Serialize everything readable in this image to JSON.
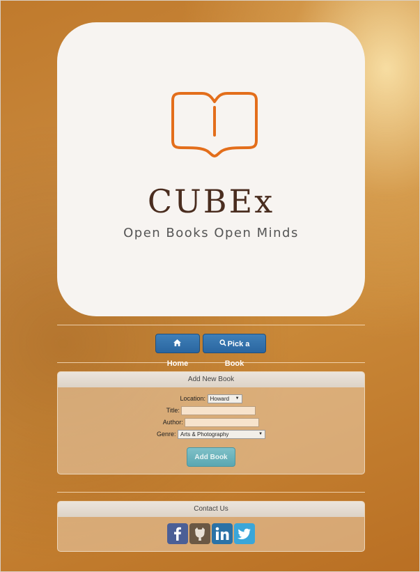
{
  "logo": {
    "brand": "CUBEx",
    "tagline": "Open Books Open Minds",
    "icon": "open-book-icon",
    "accent": "#e36e1b"
  },
  "nav": {
    "home_label": "Home",
    "home_icon": "home-icon",
    "pick_label": "Pick a Book",
    "pick_icon": "search-icon"
  },
  "add_book": {
    "header": "Add New Book",
    "location_label": "Location:",
    "location_value": "Howard",
    "title_label": "Title:",
    "title_value": "",
    "author_label": "Author:",
    "author_value": "",
    "genre_label": "Genre:",
    "genre_value": "Arts & Photography",
    "submit_label": "Add Book"
  },
  "contact": {
    "header": "Contact Us",
    "links": [
      "facebook-icon",
      "github-icon",
      "linkedin-icon",
      "twitter-icon"
    ]
  },
  "colors": {
    "nav_button": "#2a66a0",
    "add_button": "#5aa7b1",
    "facebook": "#4b5f96",
    "github": "#6b5844",
    "linkedin": "#2b72a6",
    "twitter": "#3aa6d9"
  }
}
